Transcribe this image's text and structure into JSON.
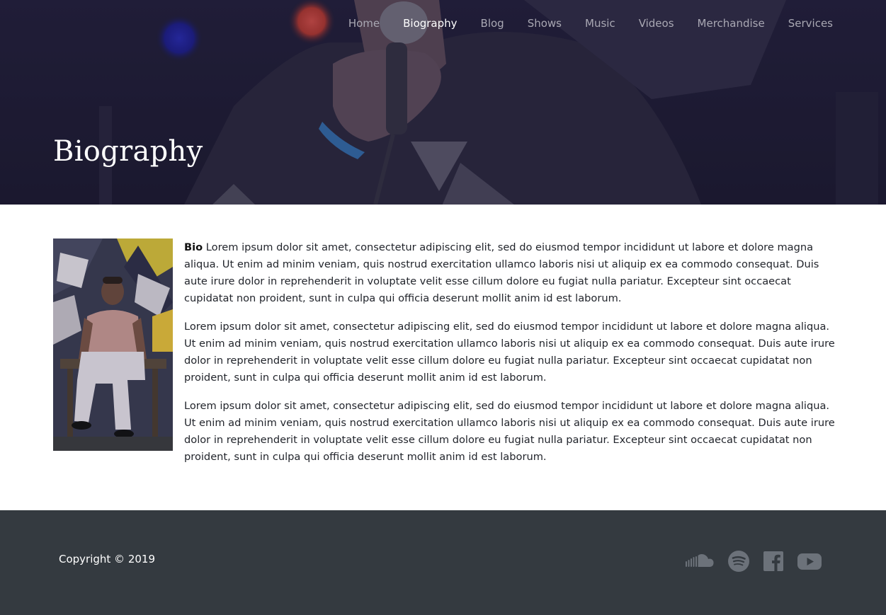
{
  "nav": {
    "items": [
      {
        "label": "Home",
        "active": false
      },
      {
        "label": "Biography",
        "active": true
      },
      {
        "label": "Blog",
        "active": false
      },
      {
        "label": "Shows",
        "active": false
      },
      {
        "label": "Music",
        "active": false
      },
      {
        "label": "Videos",
        "active": false
      },
      {
        "label": "Merchandise",
        "active": false
      },
      {
        "label": "Services",
        "active": false
      }
    ]
  },
  "hero": {
    "title": "Biography"
  },
  "bio": {
    "lead_bold": "Bio",
    "paragraphs": [
      " Lorem ipsum dolor sit amet, consectetur adipiscing elit, sed do eiusmod tempor incididunt ut labore et dolore magna aliqua. Ut enim ad minim veniam, quis nostrud exercitation ullamco laboris nisi ut aliquip ex ea commodo consequat. Duis aute irure dolor in reprehenderit in voluptate velit esse cillum dolore eu fugiat nulla pariatur. Excepteur sint occaecat cupidatat non proident, sunt in culpa qui officia deserunt mollit anim id est laborum.",
      "Lorem ipsum dolor sit amet, consectetur adipiscing elit, sed do eiusmod tempor incididunt ut labore et dolore magna aliqua. Ut enim ad minim veniam, quis nostrud exercitation ullamco laboris nisi ut aliquip ex ea commodo consequat. Duis aute irure dolor in reprehenderit in voluptate velit esse cillum dolore eu fugiat nulla pariatur. Excepteur sint occaecat cupidatat non proident, sunt in culpa qui officia deserunt mollit anim id est laborum.",
      "Lorem ipsum dolor sit amet, consectetur adipiscing elit, sed do eiusmod tempor incididunt ut labore et dolore magna aliqua. Ut enim ad minim veniam, quis nostrud exercitation ullamco laboris nisi ut aliquip ex ea commodo consequat. Duis aute irure dolor in reprehenderit in voluptate velit esse cillum dolore eu fugiat nulla pariatur. Excepteur sint occaecat cupidatat non proident, sunt in culpa qui officia deserunt mollit anim id est laborum."
    ]
  },
  "footer": {
    "copyright": "Copyright © 2019",
    "social": [
      {
        "icon": "soundcloud-icon"
      },
      {
        "icon": "spotify-icon"
      },
      {
        "icon": "facebook-icon"
      },
      {
        "icon": "youtube-icon"
      }
    ]
  },
  "colors": {
    "hero_overlay": "#221f3a",
    "nav_text": "#a9a8b3",
    "nav_active": "#ffffff",
    "footer_bg": "#343a40",
    "icon_gray": "#6c727a",
    "body_text": "#22252c"
  }
}
